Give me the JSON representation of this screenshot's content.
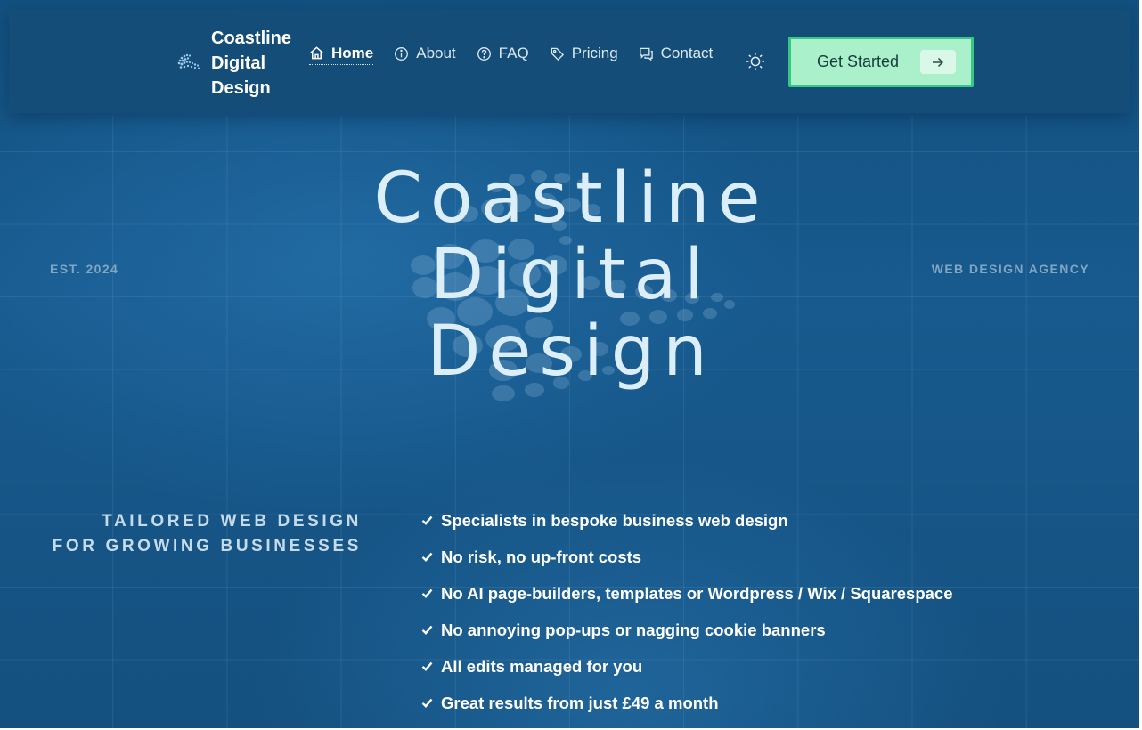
{
  "brand": {
    "name_line1": "Coastline",
    "name_line2": "Digital",
    "name_line3": "Design",
    "logo_icon": "wave-logo-icon"
  },
  "nav": {
    "items": [
      {
        "label": "Home",
        "icon": "home-icon",
        "active": true
      },
      {
        "label": "About",
        "icon": "info-icon"
      },
      {
        "label": "FAQ",
        "icon": "question-icon"
      },
      {
        "label": "Pricing",
        "icon": "tag-icon"
      },
      {
        "label": "Contact",
        "icon": "chat-icon"
      }
    ],
    "theme_toggle_icon": "sun-icon"
  },
  "cta": {
    "label": "Get Started",
    "icon": "arrow-right-icon"
  },
  "hero": {
    "est_label": "EST. 2024",
    "agency_label": "WEB DESIGN AGENCY",
    "title_line1": "Coastline",
    "title_line2": "Digital",
    "title_line3": "Design",
    "tagline_line1": "TAILORED WEB DESIGN",
    "tagline_line2": "FOR GROWING BUSINESSES"
  },
  "features": [
    "Specialists in bespoke business web design",
    "No risk, no up-front costs",
    "No AI page-builders, templates or Wordpress / Wix / Squarespace",
    "No annoying pop-ups or nagging cookie banners",
    "All edits managed for you",
    "Great results from just £49 a month"
  ],
  "colors": {
    "background": "#17578a",
    "header": "#154d79",
    "cta_fill": "#a9f0cb",
    "cta_border": "#36c985",
    "text": "#ffffff"
  }
}
